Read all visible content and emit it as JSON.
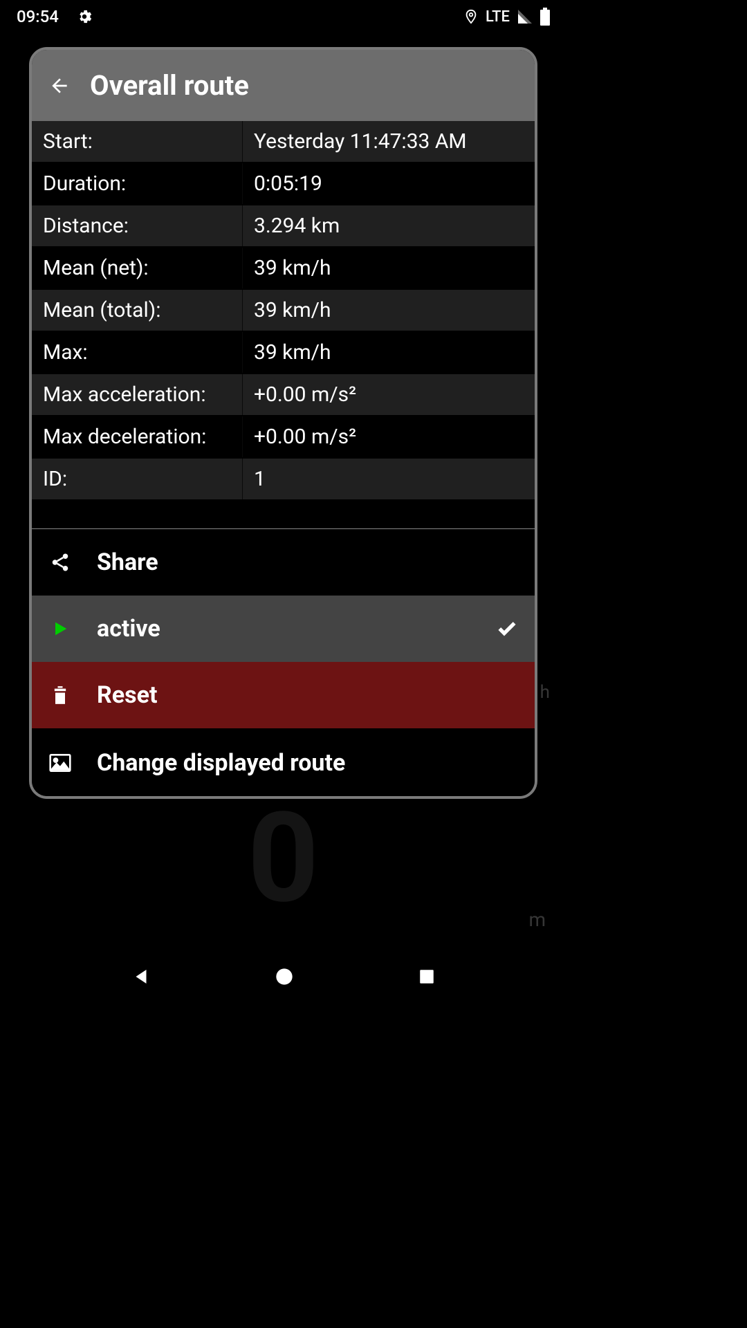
{
  "status": {
    "time": "09:54",
    "network": "LTE"
  },
  "bg": {
    "zero": "0",
    "m": "m",
    "h": "h"
  },
  "dialog": {
    "title": "Overall route",
    "stats": [
      {
        "label": "Start:",
        "value": "Yesterday 11:47:33 AM"
      },
      {
        "label": "Duration:",
        "value": "0:05:19"
      },
      {
        "label": "Distance:",
        "value": "3.294 km"
      },
      {
        "label": "Mean (net):",
        "value": "39 km/h"
      },
      {
        "label": "Mean (total):",
        "value": "39 km/h"
      },
      {
        "label": "Max:",
        "value": "39 km/h"
      },
      {
        "label": "Max acceleration:",
        "value": "+0.00 m/s²"
      },
      {
        "label": "Max deceleration:",
        "value": "+0.00 m/s²"
      },
      {
        "label": "ID:",
        "value": "1"
      }
    ],
    "actions": {
      "share": "Share",
      "active": "active",
      "reset": "Reset",
      "change": "Change displayed route"
    }
  }
}
